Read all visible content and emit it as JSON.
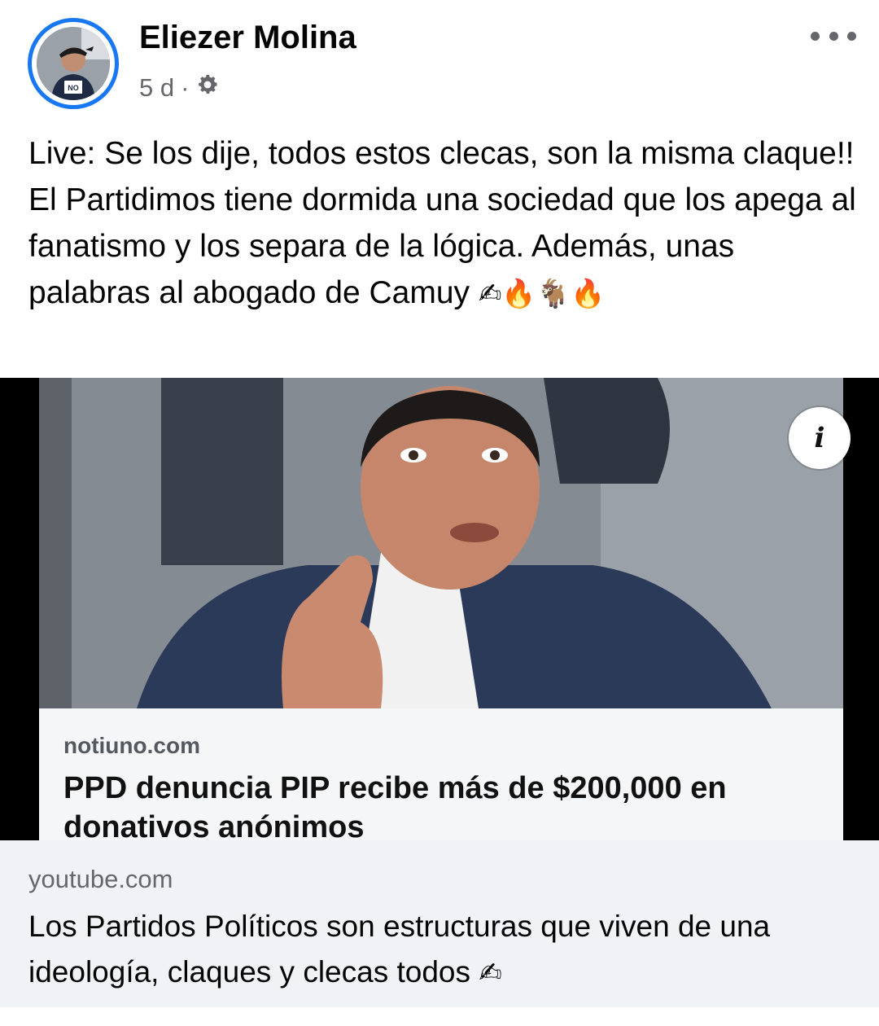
{
  "post": {
    "author": "Eliezer Molina",
    "time": "5 d",
    "separator": "·",
    "privacy_icon": "gear-icon",
    "text": "Live: Se los dije, todos estos clecas, son la misma claque!! El Partidimos tiene dormida una sociedad que los apega al fanatismo y los separa de la lógica. Además, unas palabras al abogado de Camuy",
    "text_emojis": "✍🔥🐐🔥",
    "menu_icon": "more-options-icon"
  },
  "media": {
    "info_label": "i",
    "overlay": {
      "domain": "notiuno.com",
      "headline": "PPD denuncia PIP recibe más de $200,000 en donativos anónimos"
    }
  },
  "link_preview": {
    "domain": "youtube.com",
    "title": "Los Partidos Políticos son estructuras que viven de una ideología, claques y clecas todos",
    "title_emoji": "✍"
  },
  "colors": {
    "accent": "#1877f2",
    "text": "#050505",
    "secondary": "#65676b",
    "preview_bg": "#f0f2f5"
  }
}
